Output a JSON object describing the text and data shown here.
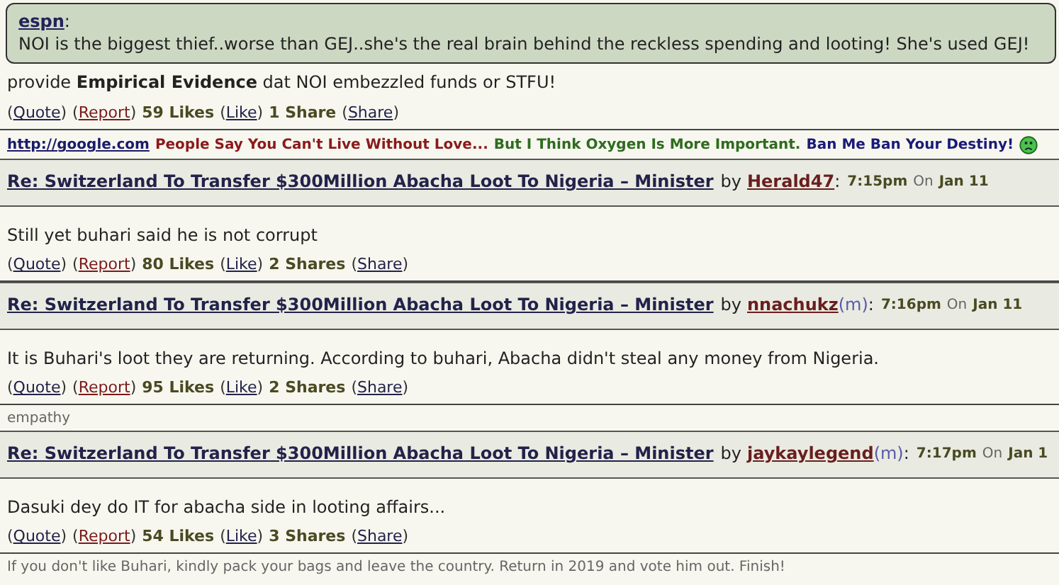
{
  "top_post": {
    "quote": {
      "author": "espn",
      "separator": ":",
      "text": "NOI is the biggest thief..worse than GEJ..she's the real brain behind the reckless spending and looting! She's used GEJ!"
    },
    "body": "provide **Empirical Evidence** dat NOI embezzled funds or STFU!",
    "actions": [
      {
        "kind": "link",
        "open": "(",
        "label": "Quote",
        "close": ")"
      },
      {
        "kind": "report",
        "open": "(",
        "label": "Report",
        "close": ")"
      },
      {
        "kind": "count",
        "label": "59 Likes"
      },
      {
        "kind": "link",
        "open": "(",
        "label": "Like",
        "close": ")"
      },
      {
        "kind": "count",
        "label": "1 Share"
      },
      {
        "kind": "link",
        "open": "(",
        "label": "Share",
        "close": ")"
      }
    ],
    "signature": [
      {
        "kind": "link",
        "text": "http://google.com"
      },
      {
        "kind": "text",
        "text": "People Say You Can't Live Without Love...",
        "color": "#8b1a1a"
      },
      {
        "kind": "text",
        "text": "But I Think Oxygen Is More Important.",
        "color": "#2e6b1e"
      },
      {
        "kind": "text",
        "text": "Ban Me Ban Your Destiny!",
        "color": "#1a1a7a"
      }
    ]
  },
  "posts": [
    {
      "header": {
        "title": "Re: Switzerland To Transfer $300Million Abacha Loot To Nigeria – Minister",
        "by": "by",
        "author": "Herald47",
        "colon": ":",
        "time": "7:15pm",
        "on": "On",
        "date": "Jan 11"
      },
      "body": "Still yet buhari said he is not corrupt",
      "actions": [
        {
          "kind": "link",
          "open": "(",
          "label": "Quote",
          "close": ")"
        },
        {
          "kind": "report",
          "open": "(",
          "label": "Report",
          "close": ")"
        },
        {
          "kind": "count",
          "label": "80 Likes"
        },
        {
          "kind": "link",
          "open": "(",
          "label": "Like",
          "close": ")"
        },
        {
          "kind": "count",
          "label": "2 Shares"
        },
        {
          "kind": "link",
          "open": "(",
          "label": "Share",
          "close": ")"
        }
      ]
    },
    {
      "header": {
        "title": "Re: Switzerland To Transfer $300Million Abacha Loot To Nigeria – Minister",
        "by": "by",
        "author": "nnachukz",
        "member_tag": "(m)",
        "colon": ":",
        "time": "7:16pm",
        "on": "On",
        "date": "Jan 11"
      },
      "body": "It is Buhari's loot they are returning. According to buhari, Abacha didn't steal any money from Nigeria.",
      "actions": [
        {
          "kind": "link",
          "open": "(",
          "label": "Quote",
          "close": ")"
        },
        {
          "kind": "report",
          "open": "(",
          "label": "Report",
          "close": ")"
        },
        {
          "kind": "count",
          "label": "95 Likes"
        },
        {
          "kind": "link",
          "open": "(",
          "label": "Like",
          "close": ")"
        },
        {
          "kind": "count",
          "label": "2 Shares"
        },
        {
          "kind": "link",
          "open": "(",
          "label": "Share",
          "close": ")"
        }
      ],
      "signature_text": "empathy"
    },
    {
      "header": {
        "title": "Re: Switzerland To Transfer $300Million Abacha Loot To Nigeria – Minister",
        "by": "by",
        "author": "jaykaylegend",
        "member_tag": "(m)",
        "colon": ":",
        "time": "7:17pm",
        "on": "On",
        "date": "Jan 1"
      },
      "body": "Dasuki dey do IT for abacha side in looting affairs...",
      "actions": [
        {
          "kind": "link",
          "open": "(",
          "label": "Quote",
          "close": ")"
        },
        {
          "kind": "report",
          "open": "(",
          "label": "Report",
          "close": ")"
        },
        {
          "kind": "count",
          "label": "54 Likes"
        },
        {
          "kind": "link",
          "open": "(",
          "label": "Like",
          "close": ")"
        },
        {
          "kind": "count",
          "label": "3 Shares"
        },
        {
          "kind": "link",
          "open": "(",
          "label": "Share",
          "close": ")"
        }
      ],
      "signature_text": "If you don't like Buhari, kindly pack your bags and leave the country. Return in 2019 and vote him out. Finish!"
    }
  ]
}
